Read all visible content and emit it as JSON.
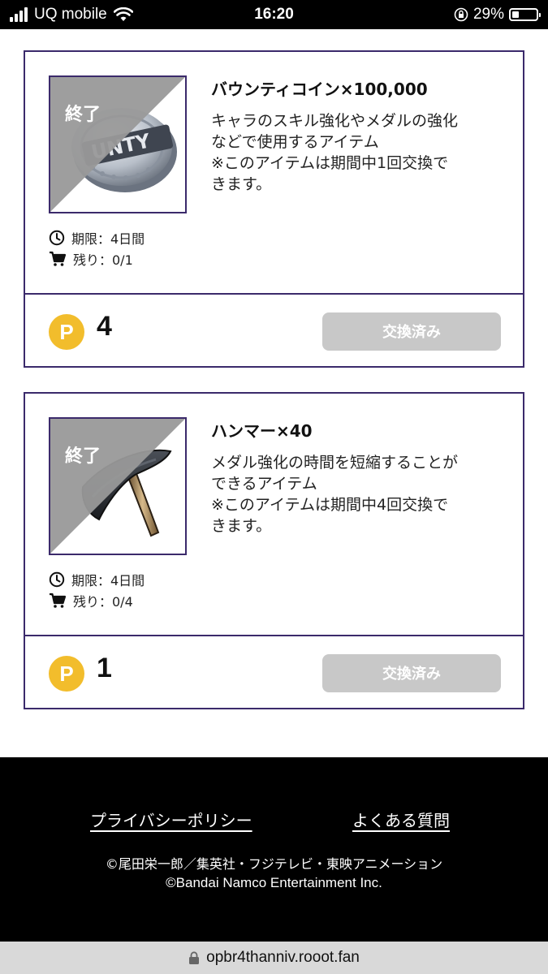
{
  "status_bar": {
    "carrier": "UQ mobile",
    "time": "16:20",
    "battery": "29%",
    "battery_level": 0.29,
    "icons": [
      "signal-bars-icon",
      "wifi-icon",
      "orientation-lock-icon",
      "battery-icon"
    ]
  },
  "items": [
    {
      "status_label": "終了",
      "title": "バウンティコイン×100,000",
      "description_lines": [
        "キャラのスキル強化やメダルの強化",
        "などで使用するアイテム",
        "※このアイテムは期間中1回交換で",
        "きます。"
      ],
      "deadline": "期限：4日間",
      "remaining": "残り：0/1",
      "points_symbol": "P",
      "points": "4",
      "button_label": "交換済み",
      "image_icon": "bounty-coin-image"
    },
    {
      "status_label": "終了",
      "title": "ハンマー×40",
      "description_lines": [
        "メダル強化の時間を短縮することが",
        "できるアイテム",
        "※このアイテムは期間中4回交換で",
        "きます。"
      ],
      "deadline": "期限：4日間",
      "remaining": "残り：0/4",
      "points_symbol": "P",
      "points": "1",
      "button_label": "交換済み",
      "image_icon": "hammer-image"
    }
  ],
  "footer": {
    "privacy_link": "プライバシーポリシー",
    "faq_link": "よくある質問",
    "copyright_line1": "©尾田栄一郎／集英社・フジテレビ・東映アニメーション",
    "copyright_line2": "©Bandai Namco Entertainment Inc."
  },
  "url_bar": {
    "url": "opbr4thanniv.rooot.fan"
  },
  "colors": {
    "card_border": "#3b2a6b",
    "point_coin": "#f2bd2c",
    "disabled_button": "#c8c8c8",
    "ended_band": "#999999"
  }
}
